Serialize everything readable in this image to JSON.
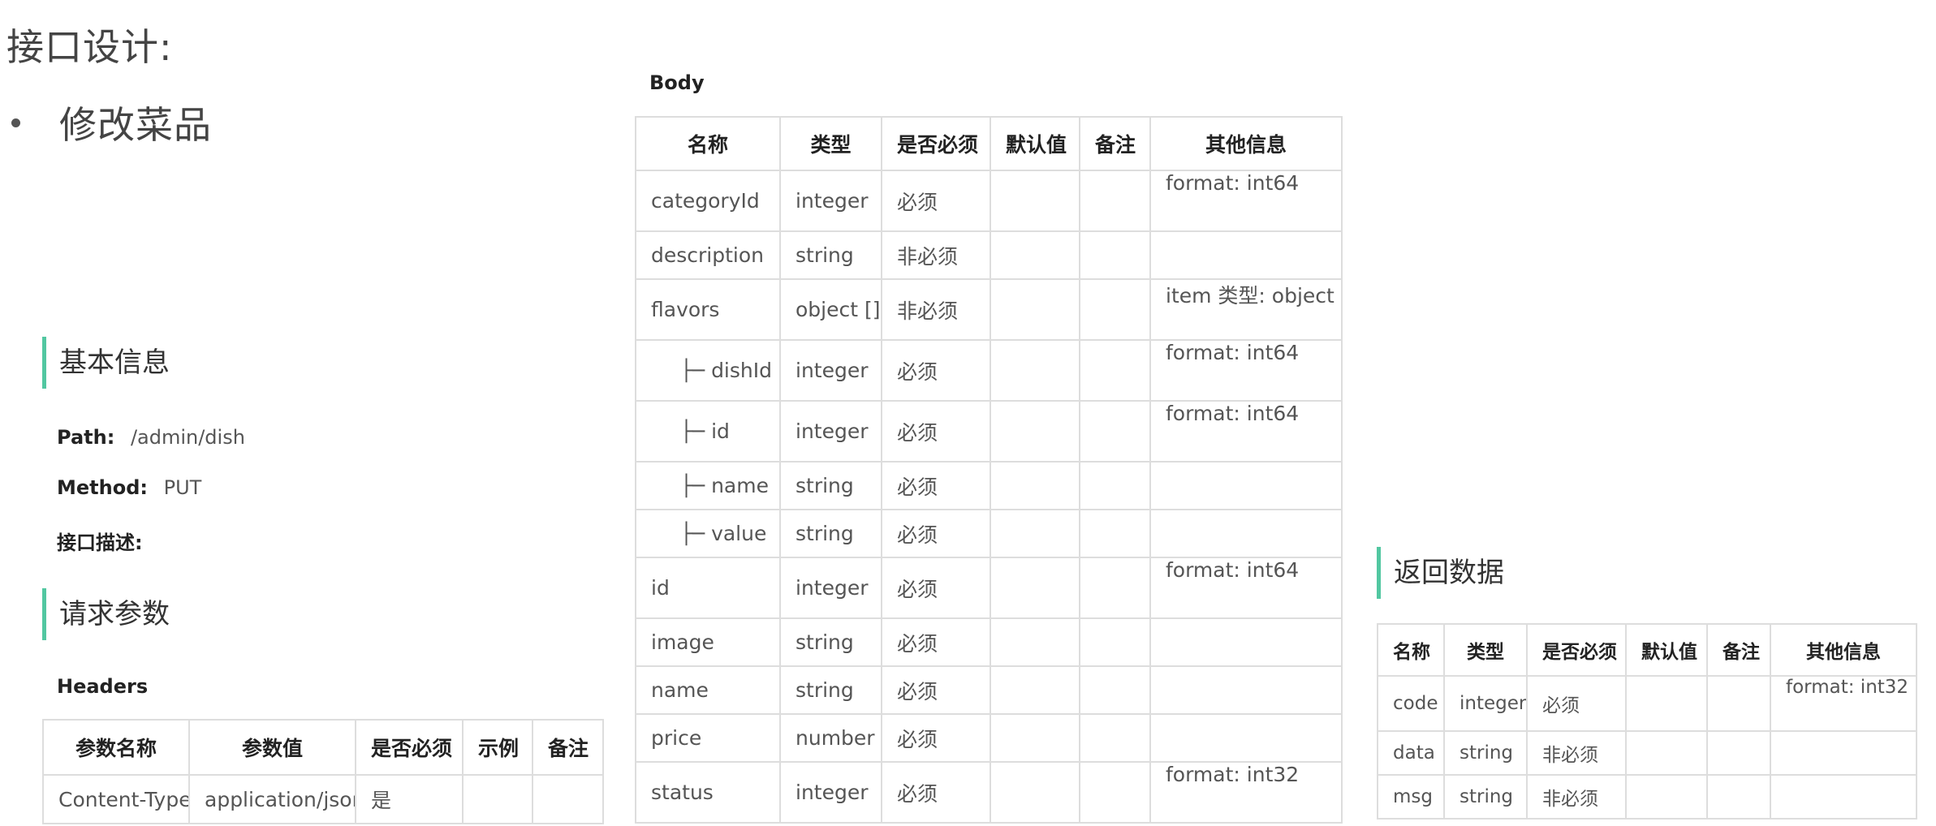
{
  "page": {
    "title": "接口设计:",
    "bullet": "修改菜品"
  },
  "basic_info": {
    "heading": "基本信息",
    "path_label": "Path:",
    "path_value": "/admin/dish",
    "method_label": "Method:",
    "method_value": "PUT",
    "desc_label": "接口描述:"
  },
  "request_params": {
    "heading": "请求参数",
    "headers_label": "Headers",
    "headers_table": {
      "columns": [
        "参数名称",
        "参数值",
        "是否必须",
        "示例",
        "备注"
      ],
      "rows": [
        [
          "Content-Type",
          "application/json",
          "是",
          "",
          ""
        ]
      ]
    }
  },
  "body": {
    "label": "Body",
    "columns": [
      "名称",
      "类型",
      "是否必须",
      "默认值",
      "备注",
      "其他信息"
    ],
    "rows": [
      {
        "name": "categoryId",
        "type": "integer",
        "required": "必须",
        "default": "",
        "note": "",
        "other": "format: int64"
      },
      {
        "name": "description",
        "type": "string",
        "required": "非必须",
        "default": "",
        "note": "",
        "other": ""
      },
      {
        "name": "flavors",
        "type": "object []",
        "required": "非必须",
        "default": "",
        "note": "",
        "other": "item 类型: object"
      },
      {
        "prefix": "├─",
        "name": "dishId",
        "type": "integer",
        "required": "必须",
        "default": "",
        "note": "",
        "other": "format: int64"
      },
      {
        "prefix": "├─",
        "name": "id",
        "type": "integer",
        "required": "必须",
        "default": "",
        "note": "",
        "other": "format: int64"
      },
      {
        "prefix": "├─",
        "name": "name",
        "type": "string",
        "required": "必须",
        "default": "",
        "note": "",
        "other": ""
      },
      {
        "prefix": "├─",
        "name": "value",
        "type": "string",
        "required": "必须",
        "default": "",
        "note": "",
        "other": ""
      },
      {
        "name": "id",
        "type": "integer",
        "required": "必须",
        "default": "",
        "note": "",
        "other": "format: int64"
      },
      {
        "name": "image",
        "type": "string",
        "required": "必须",
        "default": "",
        "note": "",
        "other": ""
      },
      {
        "name": "name",
        "type": "string",
        "required": "必须",
        "default": "",
        "note": "",
        "other": ""
      },
      {
        "name": "price",
        "type": "number",
        "required": "必须",
        "default": "",
        "note": "",
        "other": ""
      },
      {
        "name": "status",
        "type": "integer",
        "required": "必须",
        "default": "",
        "note": "",
        "other": "format: int32"
      }
    ]
  },
  "response": {
    "heading": "返回数据",
    "columns": [
      "名称",
      "类型",
      "是否必须",
      "默认值",
      "备注",
      "其他信息"
    ],
    "rows": [
      {
        "name": "code",
        "type": "integer",
        "required": "必须",
        "default": "",
        "note": "",
        "other": "format: int32"
      },
      {
        "name": "data",
        "type": "string",
        "required": "非必须",
        "default": "",
        "note": "",
        "other": ""
      },
      {
        "name": "msg",
        "type": "string",
        "required": "非必须",
        "default": "",
        "note": "",
        "other": ""
      }
    ]
  },
  "colors": {
    "accent": "#52c7a1",
    "border": "#dddddd",
    "text": "#555555",
    "heading": "#222222"
  }
}
